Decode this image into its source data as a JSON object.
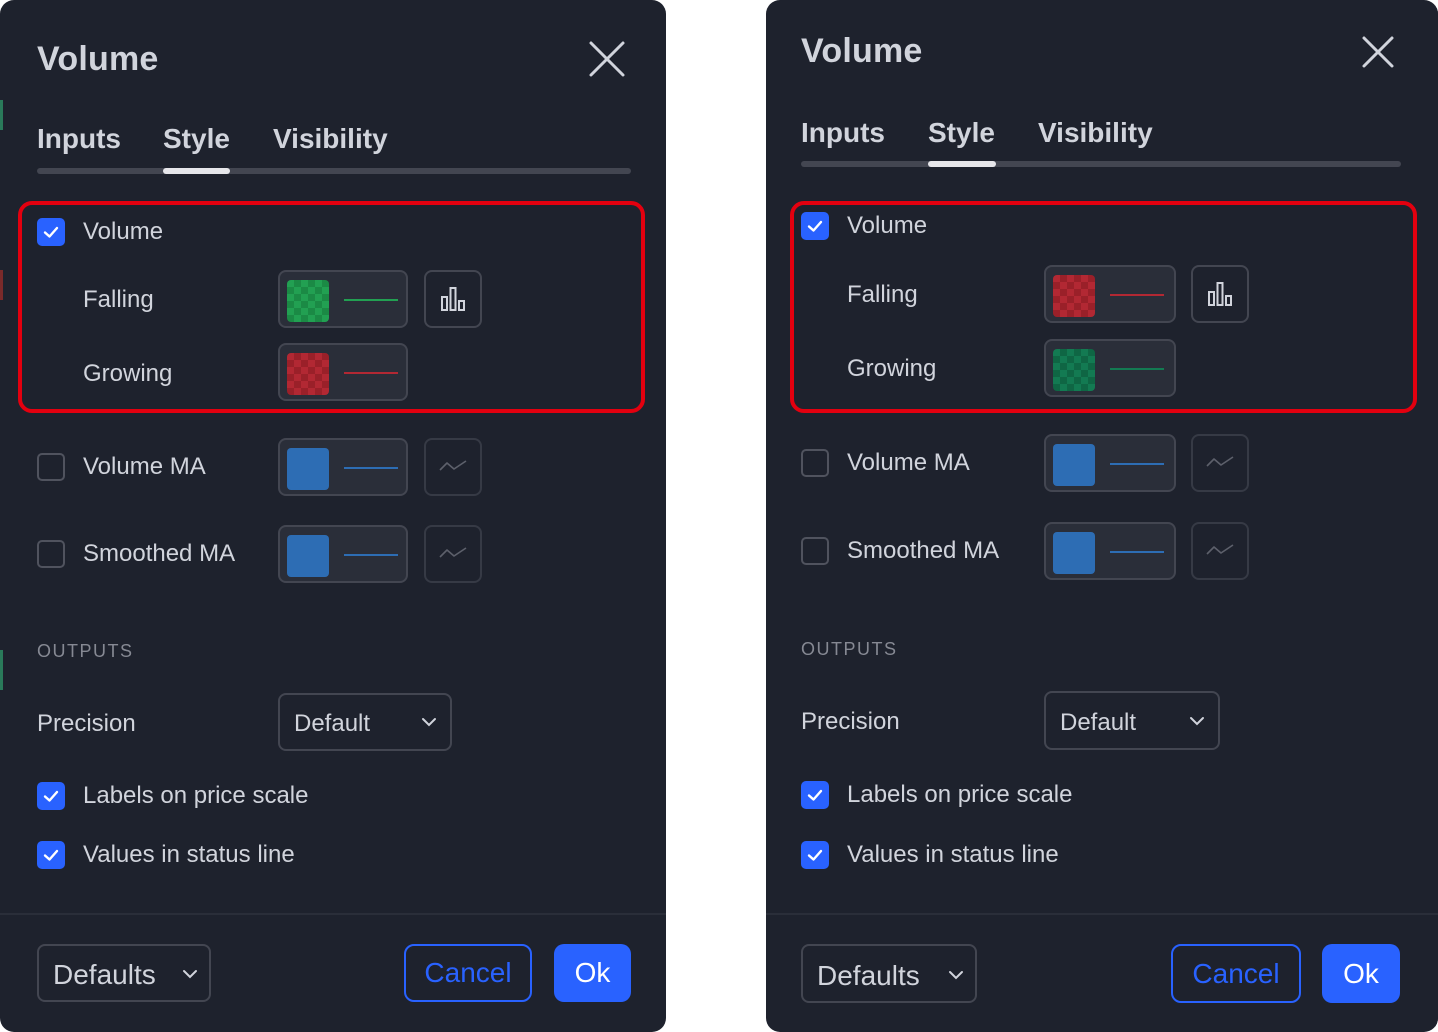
{
  "colors": {
    "background": "#1e222d",
    "accent": "#2962ff",
    "highlight": "#e3000f",
    "green": "#22a052",
    "green_dark": "#137a52",
    "red": "#b22833",
    "blue": "#2d6db4"
  },
  "panels": [
    {
      "title": "Volume",
      "tabs": [
        "Inputs",
        "Style",
        "Visibility"
      ],
      "active_tab": "Style",
      "plots": {
        "volume": {
          "label": "Volume",
          "checked": true
        },
        "falling": {
          "label": "Falling",
          "color": "green",
          "plot_style_icon": "columns-icon"
        },
        "growing": {
          "label": "Growing",
          "color": "red"
        },
        "volume_ma": {
          "label": "Volume MA",
          "checked": false,
          "color": "blue",
          "plot_style_icon": "line-icon"
        },
        "smoothed_ma": {
          "label": "Smoothed MA",
          "checked": false,
          "color": "blue",
          "plot_style_icon": "line-icon"
        }
      },
      "outputs_heading": "OUTPUTS",
      "precision": {
        "label": "Precision",
        "value": "Default"
      },
      "labels_on_price_scale": {
        "label": "Labels on price scale",
        "checked": true
      },
      "values_in_status_line": {
        "label": "Values in status line",
        "checked": true
      },
      "footer": {
        "defaults": "Defaults",
        "cancel": "Cancel",
        "ok": "Ok"
      }
    },
    {
      "title": "Volume",
      "tabs": [
        "Inputs",
        "Style",
        "Visibility"
      ],
      "active_tab": "Style",
      "plots": {
        "volume": {
          "label": "Volume",
          "checked": true
        },
        "falling": {
          "label": "Falling",
          "color": "red",
          "plot_style_icon": "columns-icon"
        },
        "growing": {
          "label": "Growing",
          "color": "dark-green"
        },
        "volume_ma": {
          "label": "Volume MA",
          "checked": false,
          "color": "blue",
          "plot_style_icon": "line-icon"
        },
        "smoothed_ma": {
          "label": "Smoothed MA",
          "checked": false,
          "color": "blue",
          "plot_style_icon": "line-icon"
        }
      },
      "outputs_heading": "OUTPUTS",
      "precision": {
        "label": "Precision",
        "value": "Default"
      },
      "labels_on_price_scale": {
        "label": "Labels on price scale",
        "checked": true
      },
      "values_in_status_line": {
        "label": "Values in status line",
        "checked": true
      },
      "footer": {
        "defaults": "Defaults",
        "cancel": "Cancel",
        "ok": "Ok"
      }
    }
  ]
}
